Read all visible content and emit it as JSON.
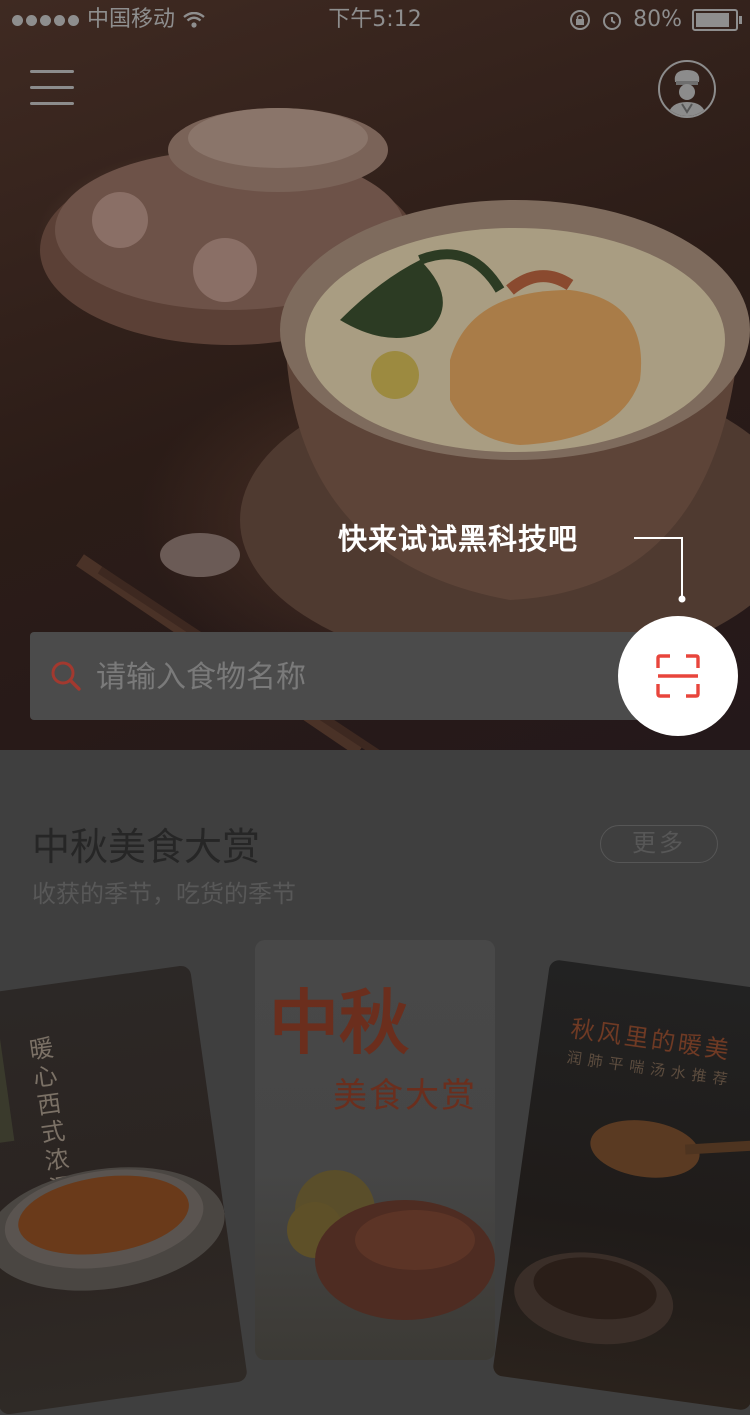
{
  "status_bar": {
    "carrier": "中国移动",
    "time": "下午5:12",
    "battery": "80%",
    "signal_bars": 5,
    "icons": [
      "signal-icon",
      "wifi-icon",
      "lock-rotation-icon",
      "alarm-icon",
      "battery-icon"
    ]
  },
  "header": {
    "menu_icon": "hamburger-menu-icon",
    "profile_icon": "chef-avatar-icon"
  },
  "hero": {
    "tip_text": "快来试试黑科技吧"
  },
  "search": {
    "placeholder": "请输入食物名称",
    "scan_icon": "scan-frame-icon"
  },
  "section": {
    "title": "中秋美食大赏",
    "subtitle": "收获的季节，吃货的季节",
    "more_label": "更多"
  },
  "cards": [
    {
      "text": "暖心西式浓汤"
    },
    {
      "calligraphy_main": "中秋",
      "calligraphy_sub": "美食大赏"
    },
    {
      "title": "秋风里的暖美",
      "subtitle": "润肺平喘汤水推荐"
    }
  ],
  "colors": {
    "accent": "#e8453c",
    "overlay_text": "#ffffff"
  }
}
